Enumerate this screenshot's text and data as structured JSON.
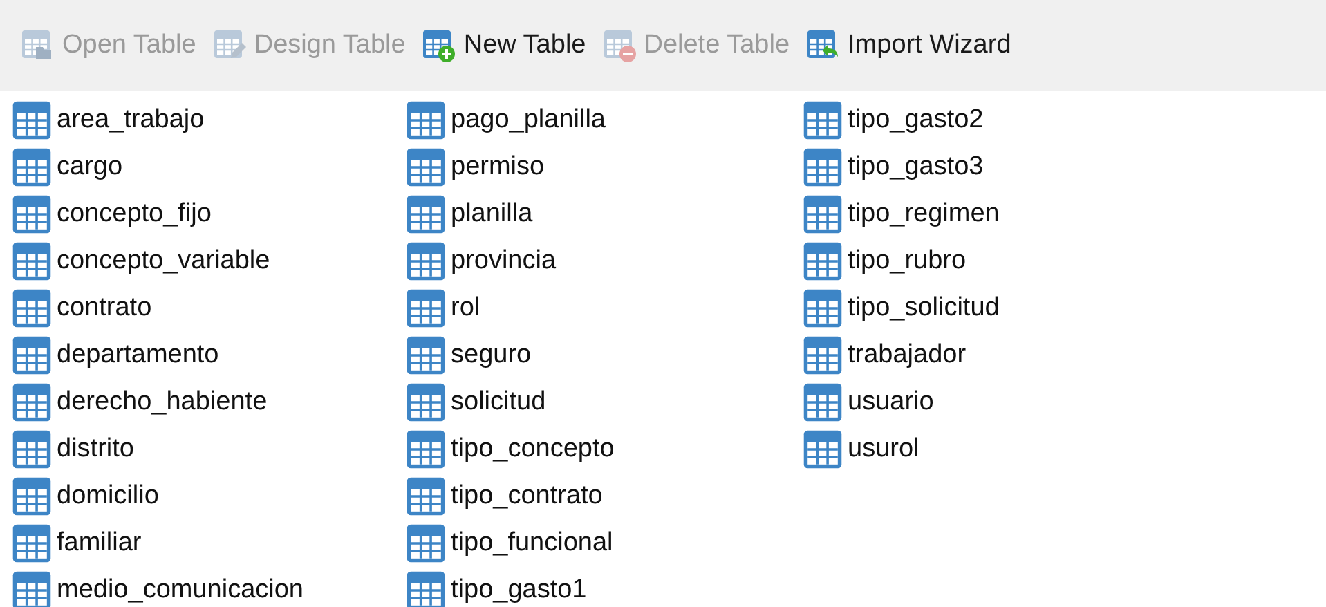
{
  "toolbar": [
    {
      "label": "Open Table",
      "kind": "open",
      "disabled": true
    },
    {
      "label": "Design Table",
      "kind": "design",
      "disabled": true
    },
    {
      "label": "New Table",
      "kind": "new",
      "disabled": false
    },
    {
      "label": "Delete Table",
      "kind": "delete",
      "disabled": true
    },
    {
      "label": "Import Wizard",
      "kind": "import",
      "disabled": false
    }
  ],
  "tables": [
    "area_trabajo",
    "cargo",
    "concepto_fijo",
    "concepto_variable",
    "contrato",
    "departamento",
    "derecho_habiente",
    "distrito",
    "domicilio",
    "familiar",
    "medio_comunicacion",
    "pago_planilla",
    "permiso",
    "planilla",
    "provincia",
    "rol",
    "seguro",
    "solicitud",
    "tipo_concepto",
    "tipo_contrato",
    "tipo_funcional",
    "tipo_gasto1",
    "tipo_gasto2",
    "tipo_gasto3",
    "tipo_regimen",
    "tipo_rubro",
    "tipo_solicitud",
    "trabajador",
    "usuario",
    "usurol"
  ]
}
